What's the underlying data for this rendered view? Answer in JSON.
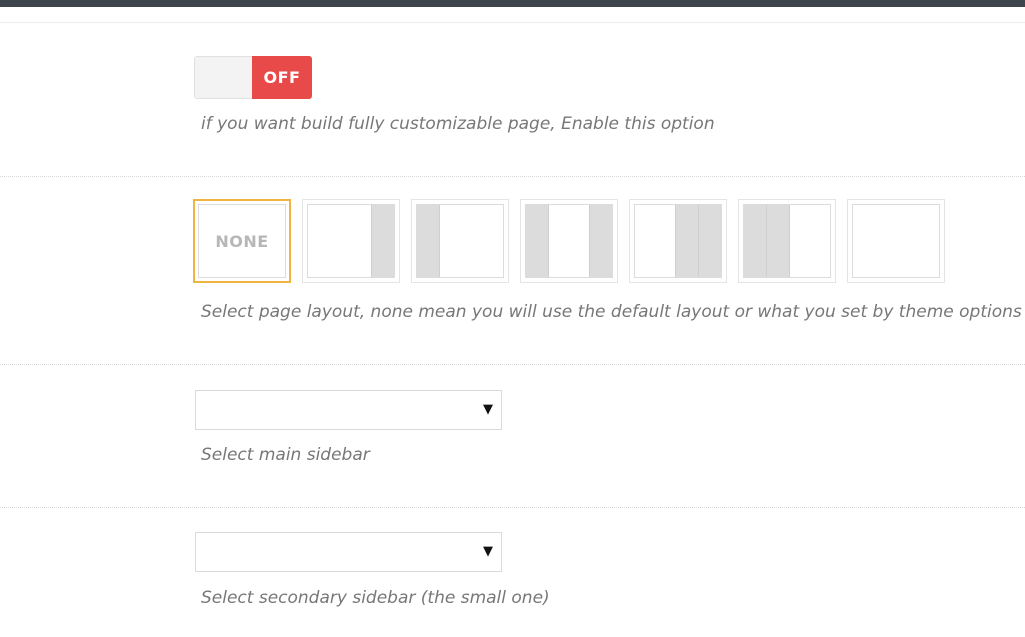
{
  "fullpage": {
    "toggle_state": "OFF",
    "description": "if you want build fully customizable page, Enable this option"
  },
  "layout": {
    "options": [
      {
        "label": "NONE"
      },
      {
        "label": ""
      },
      {
        "label": ""
      },
      {
        "label": ""
      },
      {
        "label": ""
      },
      {
        "label": ""
      },
      {
        "label": ""
      }
    ],
    "selected_index": 0,
    "description": "Select page layout, none mean you will use the default layout or what you set by theme options ->"
  },
  "main_sidebar": {
    "value": "",
    "arrow": "▼",
    "description": "Select main sidebar"
  },
  "secondary_sidebar": {
    "value": "",
    "arrow": "▼",
    "description": "Select secondary sidebar (the small one)"
  },
  "colors": {
    "toggle_off": "#e84a4a",
    "selected_border": "#f0b441",
    "top_bar": "#3e444c"
  }
}
